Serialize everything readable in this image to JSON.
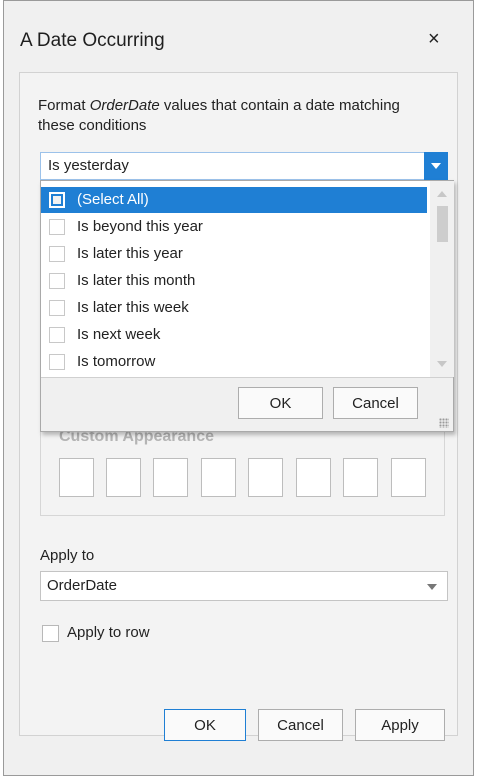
{
  "dialog": {
    "title": "A Date Occurring",
    "close_glyph": "×",
    "desc_prefix": "Format ",
    "desc_field": "OrderDate",
    "desc_suffix": " values that contain a date matching these conditions"
  },
  "condition_combo": {
    "value": "Is yesterday"
  },
  "dropdown": {
    "items": [
      {
        "label": "(Select All)",
        "selected": true
      },
      {
        "label": "Is beyond this year"
      },
      {
        "label": "Is later this year"
      },
      {
        "label": "Is later this month"
      },
      {
        "label": "Is later this week"
      },
      {
        "label": "Is next week"
      },
      {
        "label": "Is tomorrow"
      }
    ],
    "ok_label": "OK",
    "cancel_label": "Cancel"
  },
  "appearance": {
    "title": "Custom Appearance",
    "swatch_count": 8
  },
  "apply_to": {
    "label": "Apply to",
    "value": "OrderDate"
  },
  "apply_to_row": {
    "label": "Apply to row",
    "checked": false
  },
  "buttons": {
    "ok": "OK",
    "cancel": "Cancel",
    "apply": "Apply"
  },
  "colors": {
    "accent": "#1f7fd4",
    "window_bg": "#f0f0f0"
  }
}
